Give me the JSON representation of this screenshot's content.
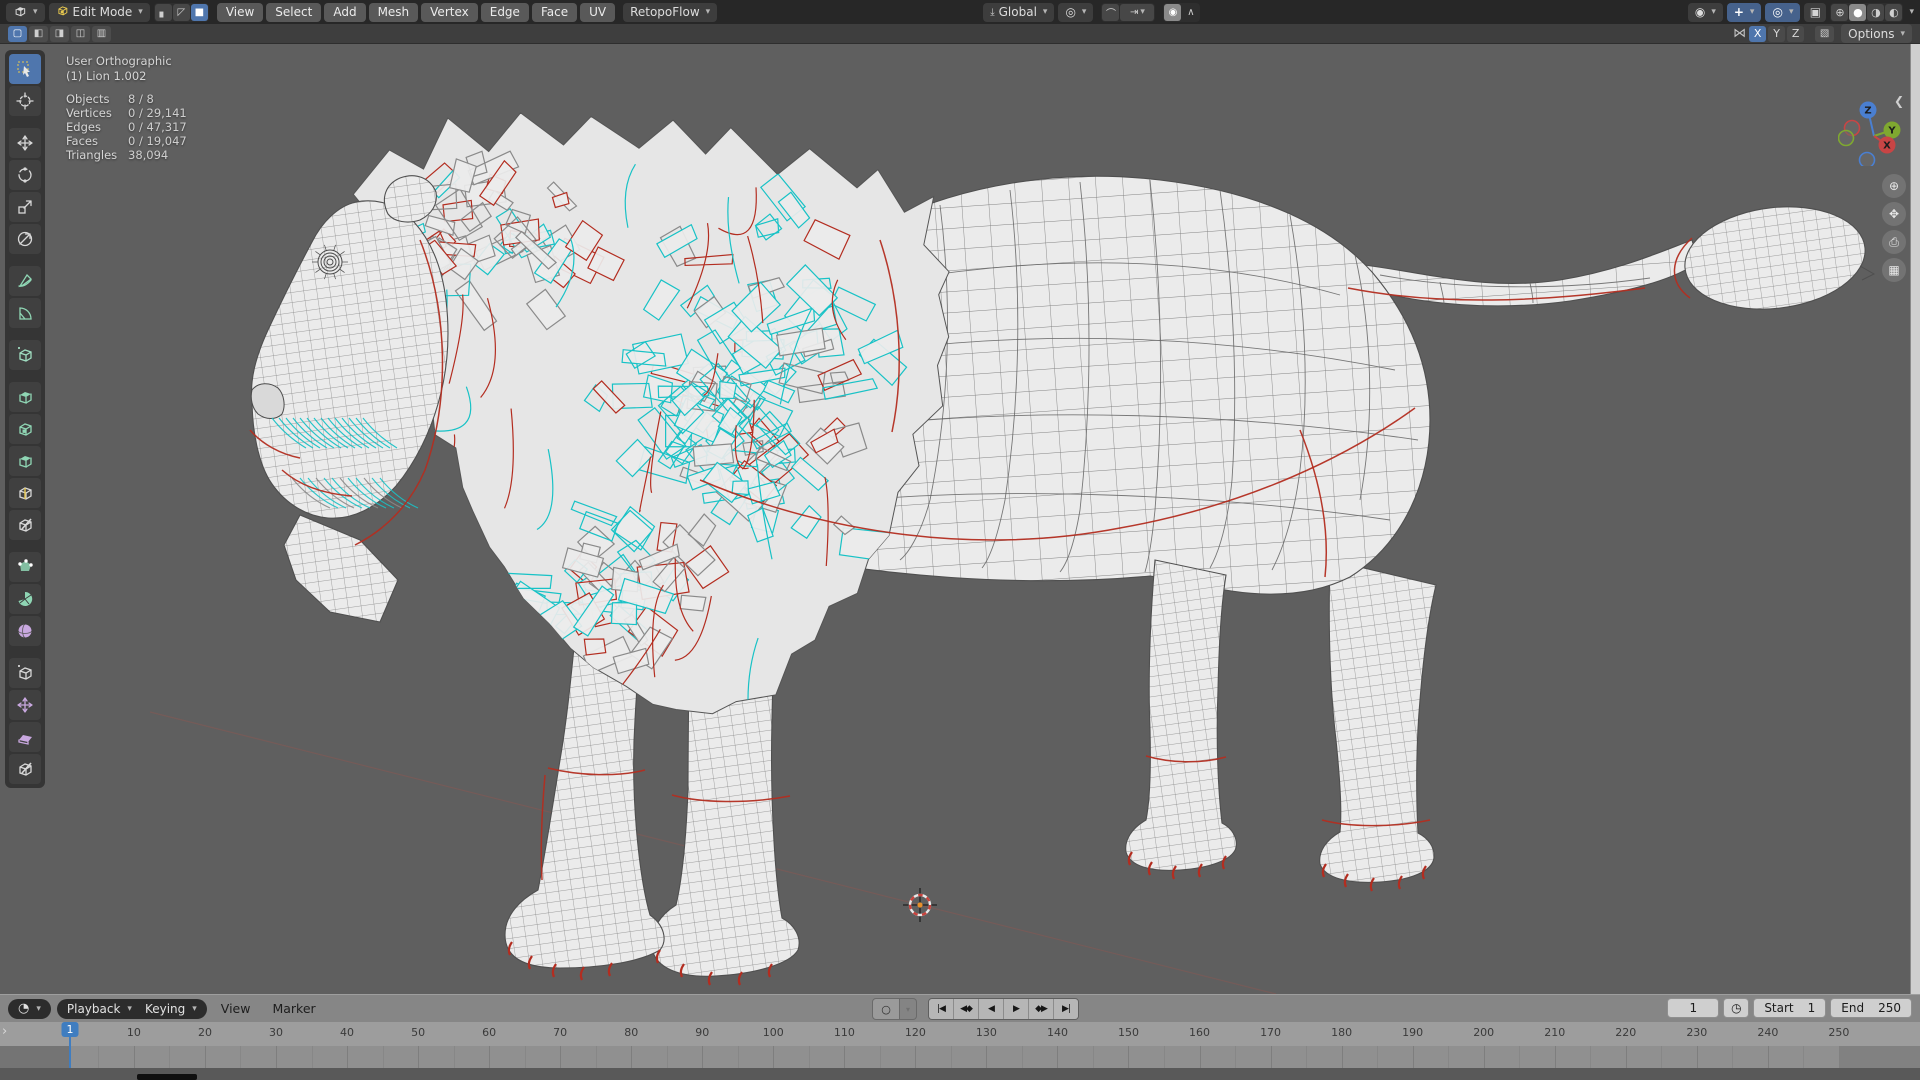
{
  "topbar": {
    "editor_type_icon": "3d-viewport-editor-icon",
    "mode_selector": {
      "label": "Edit Mode"
    },
    "select_mode_icons": [
      {
        "name": "vertex-select",
        "glyph": "▖",
        "active": false
      },
      {
        "name": "edge-select",
        "glyph": "◸",
        "active": false
      },
      {
        "name": "face-select",
        "glyph": "■",
        "active": true
      }
    ],
    "menus": [
      "View",
      "Select",
      "Add",
      "Mesh",
      "Vertex",
      "Edge",
      "Face",
      "UV"
    ],
    "retopoflow_label": "RetopoFlow",
    "orientation_label": "Global",
    "pivot_icon": "pivot-point-icon",
    "snap_icon": "magnet-icon",
    "snap_with_icon": "snap-target-icon",
    "proportional_icon": "proportional-editing-icon",
    "falloff_icon": "falloff-curve-icon",
    "right_icons": [
      "show-overlays",
      "show-gizmos",
      "overlays",
      "toggle-xray"
    ],
    "shading_modes": [
      {
        "name": "wireframe-shading",
        "glyph": "⊕",
        "active": false
      },
      {
        "name": "solid-shading",
        "glyph": "●",
        "active": true
      },
      {
        "name": "material-preview-shading",
        "glyph": "◑",
        "active": false
      },
      {
        "name": "rendered-shading",
        "glyph": "◐",
        "active": false
      }
    ]
  },
  "tool_settings": {
    "select_boolean_modes": [
      {
        "name": "mode-set",
        "glyph": "▢",
        "active": true
      },
      {
        "name": "mode-extend",
        "glyph": "◧",
        "active": false
      },
      {
        "name": "mode-subtract",
        "glyph": "◨",
        "active": false
      },
      {
        "name": "mode-invert",
        "glyph": "◫",
        "active": false
      },
      {
        "name": "mode-intersect",
        "glyph": "▥",
        "active": false
      }
    ],
    "mirror_icon": "mirror-icon",
    "mirror_axes": [
      {
        "label": "X",
        "active": true
      },
      {
        "label": "Y",
        "active": false
      },
      {
        "label": "Z",
        "active": false
      }
    ],
    "tool_options_icon": "tool-options-icon",
    "options_label": "Options"
  },
  "toolbar_tools": [
    {
      "name": "select-box",
      "kind": "arrow",
      "color": "#e8e8e8",
      "active": true
    },
    {
      "name": "cursor",
      "kind": "crosshair",
      "color": "#d8d8d8",
      "active": false
    },
    {
      "name": "move",
      "kind": "move",
      "color": "#d8d8d8",
      "active": false
    },
    {
      "name": "rotate",
      "kind": "rotate",
      "color": "#d8d8d8",
      "active": false
    },
    {
      "name": "scale",
      "kind": "scale",
      "color": "#d8d8d8",
      "active": false
    },
    {
      "name": "transform",
      "kind": "transform",
      "color": "#d8d8d8",
      "active": false
    },
    {
      "name": "annotate",
      "kind": "pen",
      "color": "#8fd6b4",
      "active": false
    },
    {
      "name": "measure",
      "kind": "protractor",
      "color": "#8fd6b4",
      "active": false
    },
    {
      "name": "add-cube",
      "kind": "cubeplus",
      "color": "#9fdcc0",
      "active": false
    },
    {
      "name": "extrude-region",
      "kind": "cubetop",
      "color": "#8fd6b4",
      "active": false
    },
    {
      "name": "inset-faces",
      "kind": "cubein",
      "color": "#8fd6b4",
      "active": false
    },
    {
      "name": "bevel",
      "kind": "cubetop",
      "color": "#8fd6b4",
      "active": false
    },
    {
      "name": "loop-cut",
      "kind": "cubeloop",
      "color": "#d8d8d8",
      "active": false
    },
    {
      "name": "knife",
      "kind": "cubeknife",
      "color": "#d8d8d8",
      "active": false
    },
    {
      "name": "poly-build",
      "kind": "poly",
      "color": "#8fd6b4",
      "active": false
    },
    {
      "name": "spin",
      "kind": "pie",
      "color": "#8fd6b4",
      "active": false
    },
    {
      "name": "smooth",
      "kind": "sphere",
      "color": "#c9a8e0",
      "active": false
    },
    {
      "name": "edge-slide",
      "kind": "cubeplus",
      "color": "#d8d8d8",
      "active": false
    },
    {
      "name": "shrink-fatten",
      "kind": "move",
      "color": "#c9a8e0",
      "active": false
    },
    {
      "name": "shear",
      "kind": "slab",
      "color": "#c9a8e0",
      "active": false
    },
    {
      "name": "rip-region",
      "kind": "cubeknife",
      "color": "#d8d8d8",
      "active": false
    }
  ],
  "viewport": {
    "overlay": {
      "view_name": "User Orthographic",
      "object_name": "(1) Lion 1.002",
      "stats": [
        {
          "label": "Objects",
          "value": "8 / 8"
        },
        {
          "label": "Vertices",
          "value": "0 / 29,141"
        },
        {
          "label": "Edges",
          "value": "0 / 47,317"
        },
        {
          "label": "Faces",
          "value": "0 / 19,047"
        },
        {
          "label": "Triangles",
          "value": "38,094"
        }
      ]
    },
    "gizmo_axes": [
      "X",
      "Y",
      "Z"
    ],
    "nav_buttons": [
      {
        "name": "zoom-button",
        "glyph": "⊕"
      },
      {
        "name": "pan-button",
        "glyph": "✥"
      },
      {
        "name": "camera-view-button",
        "glyph": "⌦"
      },
      {
        "name": "perspective-grid-button",
        "glyph": "▦"
      }
    ],
    "colors": {
      "background": "#5f5f5f",
      "surface": "#ebebeb",
      "wire": "#696969",
      "selected_edge": "#18c2c6",
      "seam": "#b32d20",
      "axis_x": "#c84545",
      "axis_y": "#7fa830",
      "axis_z": "#4a7fd1",
      "cursor_center": "#e8902c",
      "active_blue": "#4f76ad"
    }
  },
  "timeline": {
    "editor_icon": "timeline-editor-icon",
    "dropdown_menus": [
      "Playback",
      "Keying"
    ],
    "flat_menus": [
      "View",
      "Marker"
    ],
    "transport": [
      {
        "name": "jump-to-start",
        "glyph": "|◀"
      },
      {
        "name": "prev-keyframe",
        "glyph": "◀◆"
      },
      {
        "name": "play-reverse",
        "glyph": "◀"
      },
      {
        "name": "play",
        "glyph": "▶"
      },
      {
        "name": "next-keyframe",
        "glyph": "◆▶"
      },
      {
        "name": "jump-to-end",
        "glyph": "▶|"
      }
    ],
    "record_icon": "record-circle-icon",
    "current_frame": "1",
    "start_label": "Start",
    "start_value": "1",
    "end_label": "End",
    "end_value": "250",
    "ruler_ticks": [
      10,
      20,
      30,
      40,
      50,
      60,
      70,
      80,
      90,
      100,
      110,
      120,
      130,
      140,
      150,
      160,
      170,
      180,
      190,
      200,
      210,
      220,
      230,
      240,
      250
    ]
  }
}
